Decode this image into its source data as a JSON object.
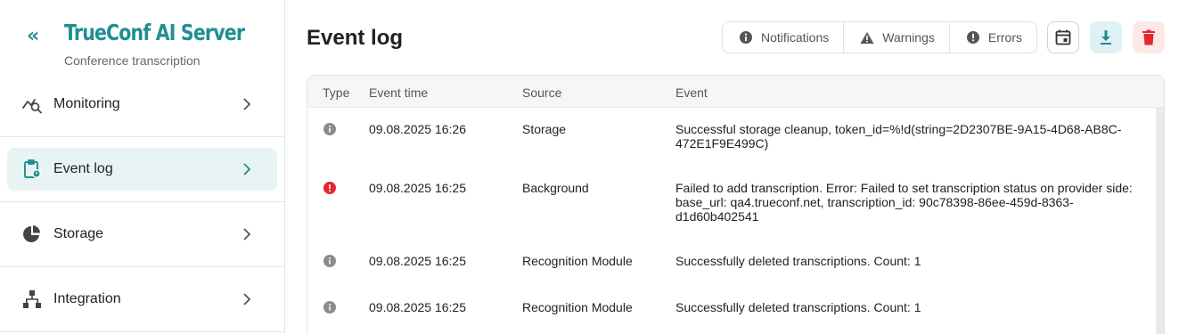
{
  "brand": {
    "title": "TrueConf AI Server",
    "subtitle": "Conference transcription"
  },
  "sidebar": {
    "items": [
      {
        "label": "Monitoring",
        "icon": "monitoring-icon",
        "active": false
      },
      {
        "label": "Event log",
        "icon": "clipboard-icon",
        "active": true
      },
      {
        "label": "Storage",
        "icon": "pie-chart-icon",
        "active": false
      },
      {
        "label": "Integration",
        "icon": "hierarchy-icon",
        "active": false
      }
    ]
  },
  "page": {
    "title": "Event log"
  },
  "filters": {
    "notifications": "Notifications",
    "warnings": "Warnings",
    "errors": "Errors"
  },
  "table": {
    "columns": {
      "type": "Type",
      "time": "Event time",
      "source": "Source",
      "event": "Event"
    },
    "rows": [
      {
        "type": "info",
        "time": "09.08.2025 16:26",
        "source": "Storage",
        "event": "Successful storage cleanup, token_id=%!d(string=2D2307BE-9A15-4D68-AB8C-472E1F9E499C)"
      },
      {
        "type": "error",
        "time": "09.08.2025 16:25",
        "source": "Background",
        "event": "Failed to add transcription. Error: Failed to set transcription status on provider side: base_url: qa4.trueconf.net, transcription_id: 90c78398-86ee-459d-8363-d1d60b402541"
      },
      {
        "type": "info",
        "time": "09.08.2025 16:25",
        "source": "Recognition Module",
        "event": "Successfully deleted transcriptions. Count: 1"
      },
      {
        "type": "info",
        "time": "09.08.2025 16:25",
        "source": "Recognition Module",
        "event": "Successfully deleted transcriptions. Count: 1"
      }
    ]
  },
  "colors": {
    "accent": "#1f8f92",
    "error": "#e5282f",
    "info": "#8a8d90",
    "delete": "#e5282f"
  }
}
